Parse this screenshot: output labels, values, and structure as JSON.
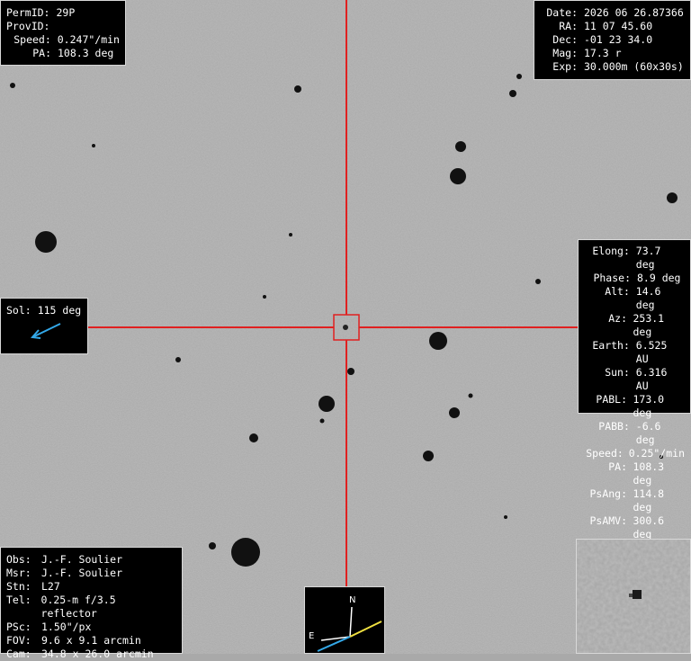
{
  "object": {
    "permid_label": "PermID:",
    "permid": "29P",
    "provid_label": "ProvID:",
    "provid": "",
    "speed_label": "Speed:",
    "speed": "0.247\"/min",
    "pa_label": "PA:",
    "pa": "108.3 deg"
  },
  "obs_info": {
    "date_label": "Date:",
    "date": "2026 06 26.87366",
    "ra_label": "RA:",
    "ra": "11 07 45.60",
    "dec_label": "Dec:",
    "dec": "-01 23 34.0",
    "mag_label": "Mag:",
    "mag": "17.3 r",
    "exp_label": "Exp:",
    "exp": "30.000m (60x30s)"
  },
  "geometry": [
    {
      "label": "Elong:",
      "value": "73.7 deg"
    },
    {
      "label": "Phase:",
      "value": "8.9 deg"
    },
    {
      "label": "Alt:",
      "value": "14.6 deg"
    },
    {
      "label": "Az:",
      "value": "253.1 deg"
    },
    {
      "label": "Earth:",
      "value": "6.525 AU"
    },
    {
      "label": "Sun:",
      "value": "6.316 AU"
    },
    {
      "label": "PABL:",
      "value": "173.0 deg"
    },
    {
      "label": "PABB:",
      "value": "-6.6 deg"
    },
    {
      "label": "Speed:",
      "value": "0.25\"/min"
    },
    {
      "label": "PA:",
      "value": "108.3 deg"
    },
    {
      "label": "PsAng:",
      "value": "114.8 deg"
    },
    {
      "label": "PsAMV:",
      "value": "300.6 deg"
    }
  ],
  "sol": {
    "label": "Sol:",
    "value": "115 deg",
    "arrow_color": "#33a8e8"
  },
  "observer": [
    {
      "label": "Obs:",
      "value": "J.-F. Soulier"
    },
    {
      "label": "Msr:",
      "value": "J.-F. Soulier"
    },
    {
      "label": "Stn:",
      "value": "L27"
    },
    {
      "label": "Tel:",
      "value": "0.25-m f/3.5 reflector"
    },
    {
      "label": "PSc:",
      "value": "1.50\"/px"
    },
    {
      "label": "FOV:",
      "value": "9.6 x 9.1 arcmin"
    },
    {
      "label": "Cam:",
      "value": "34.8 x 26.0 arcmin"
    }
  ],
  "compass": {
    "north": "N",
    "east": "E",
    "motion_color": "#f0e040",
    "sun_color": "#33a8e8"
  },
  "crosshair_color": "#e02020"
}
